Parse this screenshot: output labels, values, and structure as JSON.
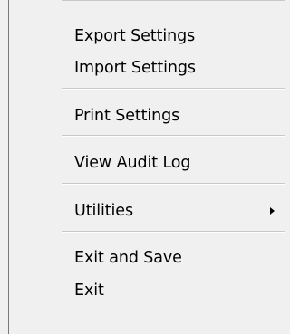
{
  "menu": {
    "items": [
      {
        "label": "Export Settings"
      },
      {
        "label": "Import Settings"
      },
      {
        "label": "Print Settings"
      },
      {
        "label": "View Audit Log"
      },
      {
        "label": "Utilities",
        "has_submenu": true,
        "submenu_icon": "chevron-right-icon"
      },
      {
        "label": "Exit and Save"
      },
      {
        "label": "Exit"
      }
    ]
  },
  "colors": {
    "menu_background": "#f0f0f0",
    "separator": "#c9c9c9",
    "border": "#7a7a7a",
    "text": "#000000"
  }
}
